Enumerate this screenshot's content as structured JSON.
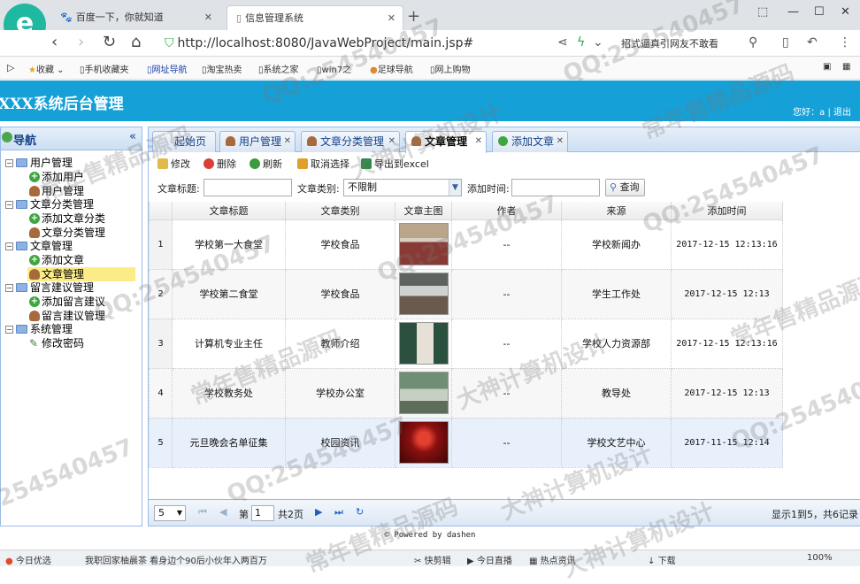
{
  "browser": {
    "tabs": [
      {
        "label": "百度一下，你就知道"
      },
      {
        "label": "信息管理系统"
      }
    ],
    "url": "http://localhost:8080/JavaWebProject/main.jsp#",
    "suggest": "招式逼真引网友不敢看",
    "bookmarks": [
      "收藏",
      "手机收藏夹",
      "网址导航",
      "淘宝热卖",
      "系统之家",
      "win7之",
      "足球导航",
      "网上购物"
    ]
  },
  "app": {
    "title": "XXX系统后台管理",
    "greeting": "您好：a",
    "logout": "退出"
  },
  "sidebar": {
    "title": "导航",
    "groups": [
      {
        "label": "用户管理",
        "items": [
          {
            "label": "添加用户",
            "icon": "add-icon"
          },
          {
            "label": "用户管理",
            "icon": "user-icon"
          }
        ]
      },
      {
        "label": "文章分类管理",
        "items": [
          {
            "label": "添加文章分类",
            "icon": "add-icon"
          },
          {
            "label": "文章分类管理",
            "icon": "user-icon"
          }
        ]
      },
      {
        "label": "文章管理",
        "items": [
          {
            "label": "添加文章",
            "icon": "add-icon"
          },
          {
            "label": "文章管理",
            "icon": "user-icon"
          }
        ]
      },
      {
        "label": "留言建议管理",
        "items": [
          {
            "label": "添加留言建议",
            "icon": "add-icon"
          },
          {
            "label": "留言建议管理",
            "icon": "user-icon"
          }
        ]
      },
      {
        "label": "系统管理",
        "items": [
          {
            "label": "修改密码",
            "icon": "pen-icon"
          }
        ]
      }
    ],
    "selected": "文章管理"
  },
  "tabs": [
    {
      "label": "起始页"
    },
    {
      "label": "用户管理"
    },
    {
      "label": "文章分类管理"
    },
    {
      "label": "文章管理"
    },
    {
      "label": "添加文章"
    }
  ],
  "toolbar": {
    "edit": "修改",
    "delete": "删除",
    "refresh": "刷新",
    "cancel_select": "取消选择",
    "export": "导出到excel"
  },
  "filters": {
    "title_label": "文章标题:",
    "title_value": "",
    "type_label": "文章类别:",
    "type_value": "不限制",
    "time_label": "添加时间:",
    "time_value": "",
    "query": "查询"
  },
  "grid": {
    "columns": [
      "文章标题",
      "文章类别",
      "文章主图",
      "作者",
      "来源",
      "添加时间"
    ],
    "rows": [
      {
        "n": "1",
        "title": "学校第一大食堂",
        "type": "学校食品",
        "author": "--",
        "source": "学校新闻办",
        "time": "2017-12-15 12:13:16"
      },
      {
        "n": "2",
        "title": "学校第二食堂",
        "type": "学校食品",
        "author": "--",
        "source": "学生工作处",
        "time": "2017-12-15 12:13"
      },
      {
        "n": "3",
        "title": "计算机专业主任",
        "type": "教师介绍",
        "author": "--",
        "source": "学校人力资源部",
        "time": "2017-12-15 12:13:16"
      },
      {
        "n": "4",
        "title": "学校教务处",
        "type": "学校办公室",
        "author": "--",
        "source": "教导处",
        "time": "2017-12-15 12:13"
      },
      {
        "n": "5",
        "title": "元旦晚会名单征集",
        "type": "校园资讯",
        "author": "--",
        "source": "学校文艺中心",
        "time": "2017-11-15 12:14"
      }
    ]
  },
  "pager": {
    "page_size": "5",
    "page_prefix": "第",
    "page_value": "1",
    "page_total": "共2页",
    "info": "显示1到5，共6记录"
  },
  "footer": "© Powered by dashen",
  "statusbar": [
    "今日优选",
    "我职回家柚晨茶 看身边个90后小伙年入两百万",
    "快剪辑",
    "今日直播",
    "热点资讯",
    "下载",
    "100%"
  ],
  "watermarks": [
    "QQ:254540457",
    "常年售精品源码",
    "大神计算机设计"
  ]
}
